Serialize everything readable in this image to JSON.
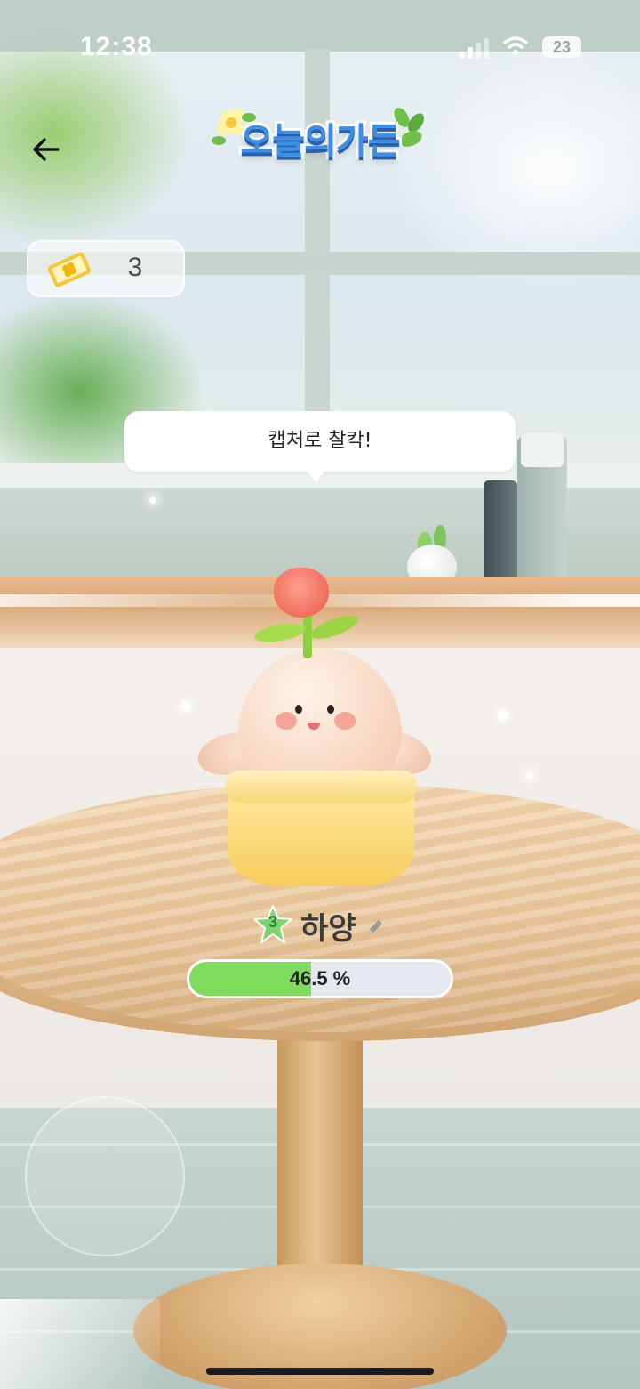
{
  "status_bar": {
    "time": "12:38",
    "battery": "23",
    "icons": [
      "signal-icon",
      "wifi-icon",
      "battery-icon"
    ]
  },
  "header": {
    "back_icon": "arrow-left-icon",
    "logo_text": "오늘의가든"
  },
  "ticket": {
    "icon": "clover-ticket-icon",
    "count": "3"
  },
  "speech_bubble": {
    "text": "캡처로 찰칵!"
  },
  "plant": {
    "level": "3",
    "name": "하양",
    "edit_icon": "pencil-icon",
    "growth_fraction": 0.465,
    "progress_label": "46.5 %"
  },
  "colors": {
    "progress_fill": "#7fdb5c",
    "progress_track": "#e6e8ef",
    "logo_blue": "#3c8fe6",
    "level_star": "#7ed56f"
  }
}
